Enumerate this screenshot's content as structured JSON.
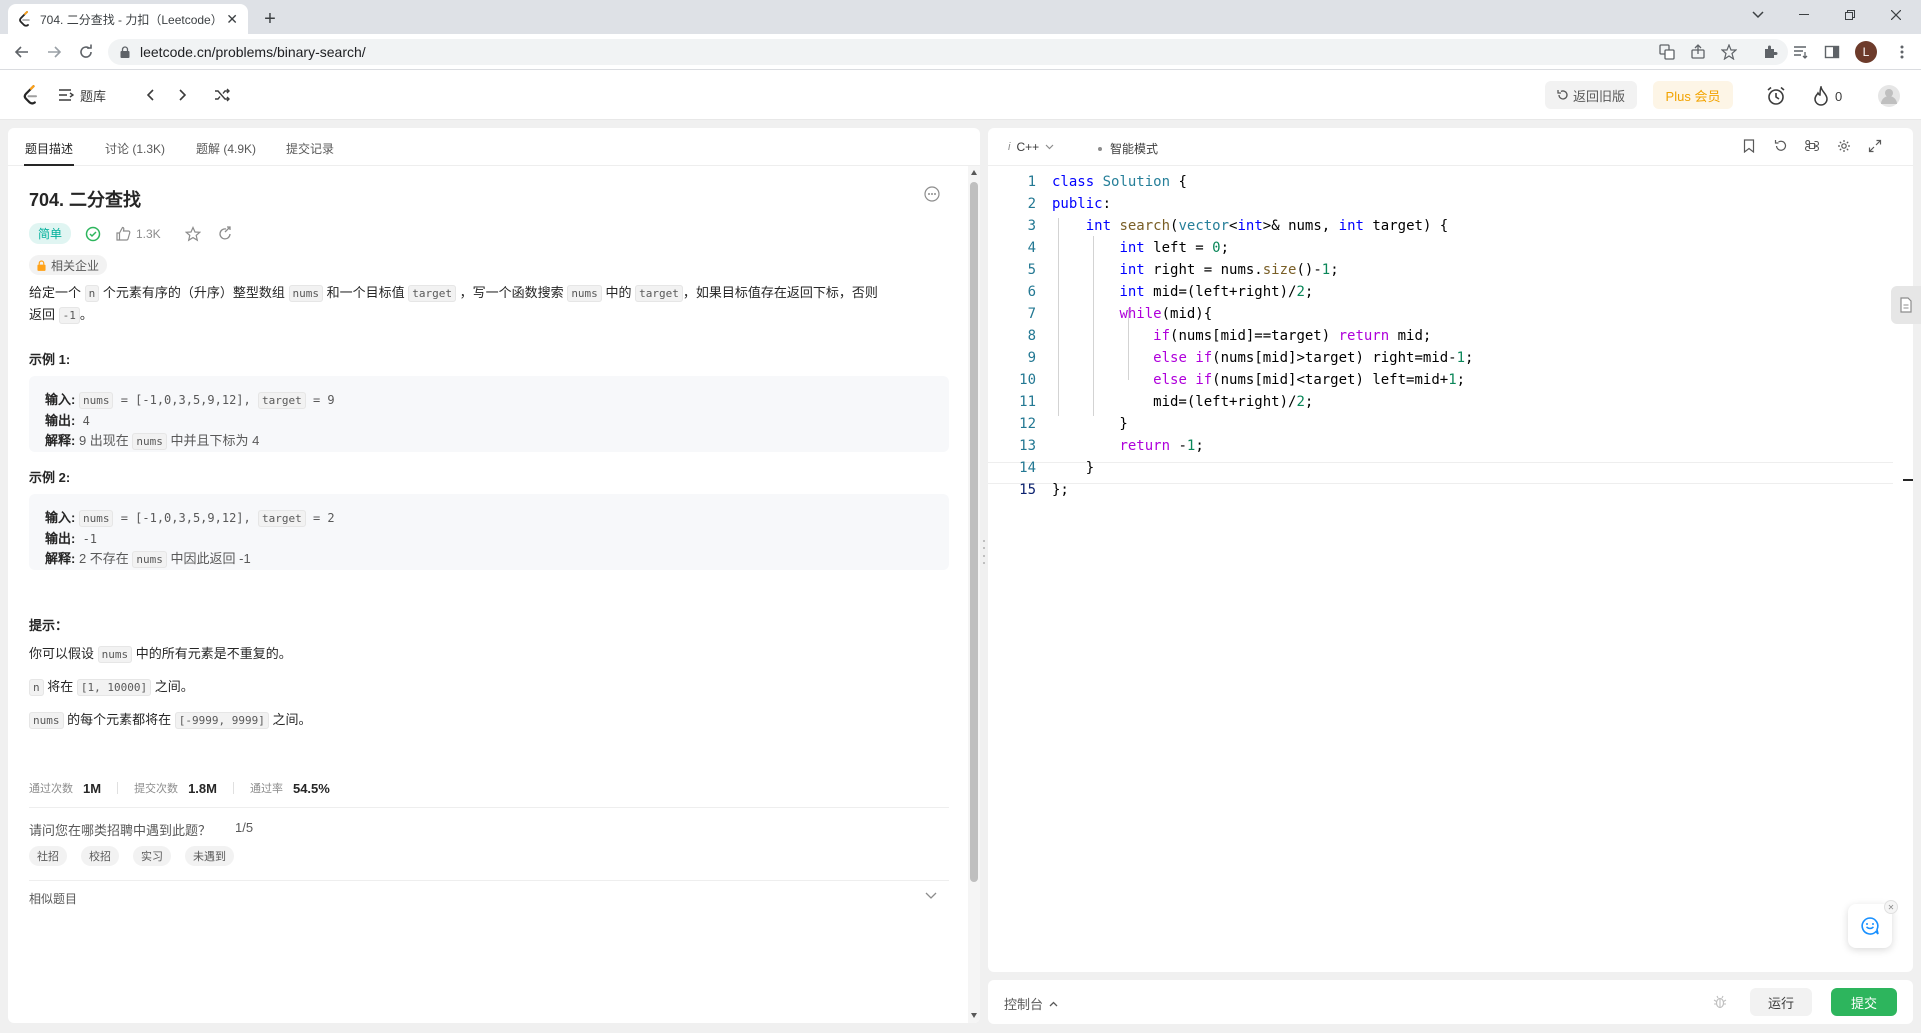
{
  "browser": {
    "tab_title": "704. 二分查找 - 力扣（Leetcode）",
    "url": "leetcode.cn/problems/binary-search/",
    "profile_initial": "L"
  },
  "header": {
    "problem_bank": "题库",
    "old_version": "返回旧版",
    "plus": "Plus 会员",
    "streak_count": "0"
  },
  "left_tabs": [
    "题目描述",
    "讨论 (1.3K)",
    "题解 (4.9K)",
    "提交记录"
  ],
  "problem": {
    "title": "704. 二分查找",
    "difficulty": "简单",
    "likes": "1.3K",
    "related_companies": "相关企业",
    "desc_1": "给定一个",
    "desc_2": "个元素有序的（升序）整型数组",
    "desc_3": "和一个目标值",
    "desc_4": "，写一个函数搜索",
    "desc_5": "中的",
    "desc_6": "，如果目标值存在返回下标，否则",
    "desc_7": "返回",
    "desc_8": "。",
    "code_n": "n",
    "code_nums": "nums",
    "code_target": "target",
    "code_neg1": "-1"
  },
  "examples": [
    {
      "heading": "示例 1:",
      "input_label": "输入:",
      "input_rest_1": " = [-1,0,3,5,9,12], ",
      "input_rest_2": " = 9",
      "output_label": "输出:",
      "output": " 4",
      "explain_label": "解释:",
      "explain_1": " 9 出现在 ",
      "explain_2": " 中并且下标为 4"
    },
    {
      "heading": "示例 2:",
      "input_label": "输入:",
      "input_rest_1": " = [-1,0,3,5,9,12], ",
      "input_rest_2": " = 2",
      "output_label": "输出:",
      "output": " -1",
      "explain_label": "解释:",
      "explain_1": " 2 不存在 ",
      "explain_2": " 中因此返回 -1"
    }
  ],
  "hints": {
    "heading": "提示：",
    "h1_a": "你可以假设",
    "h1_b": "中的所有元素是不重复的。",
    "h2_a": "将在",
    "h2_code": "[1, 10000]",
    "h2_b": "之间。",
    "h3_a": "的每个元素都将在",
    "h3_code": "[-9999, 9999]",
    "h3_b": "之间。"
  },
  "stats": {
    "accepted_label": "通过次数",
    "accepted": "1M",
    "submissions_label": "提交次数",
    "submissions": "1.8M",
    "rate_label": "通过率",
    "rate": "54.5%"
  },
  "interview": {
    "question": "请问您在哪类招聘中遇到此题？",
    "progress": "1/5",
    "chips": [
      "社招",
      "校招",
      "实习",
      "未遇到"
    ]
  },
  "similar_label": "相似题目",
  "editor": {
    "language": "C++",
    "mode": "智能模式",
    "lines": [
      "1",
      "2",
      "3",
      "4",
      "5",
      "6",
      "7",
      "8",
      "9",
      "10",
      "11",
      "12",
      "13",
      "14",
      "15"
    ]
  },
  "console": {
    "label": "控制台",
    "run": "运行",
    "submit": "提交"
  },
  "colors": {
    "accent_green": "#2db55d",
    "easy_green": "#00af9b",
    "plus_orange": "#f2a300"
  }
}
